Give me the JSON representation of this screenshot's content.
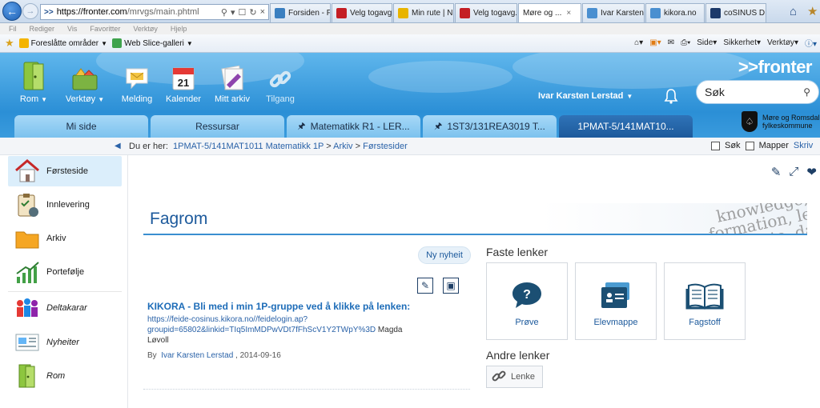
{
  "browser": {
    "address": {
      "proto": ">>",
      "host": "https://fronter.com",
      "path": "/mrvgs/main.phtml"
    },
    "tabs": [
      {
        "label": "Forsiden - F...",
        "color": "#3a7fc0",
        "active": false
      },
      {
        "label": "Velg togavg...",
        "color": "#c41e24",
        "active": false
      },
      {
        "label": "Min rute | N...",
        "color": "#e8b400",
        "active": false
      },
      {
        "label": "Velg togavg...",
        "color": "#c41e24",
        "active": false
      },
      {
        "label": "Møre og ...",
        "color": "#1d5a9c",
        "active": true
      },
      {
        "label": "Ivar Karsten ...",
        "color": "#4a8fd0",
        "active": false
      },
      {
        "label": "kikora.no",
        "color": "#4a8fd0",
        "active": false
      },
      {
        "label": "coSINUS DI...",
        "color": "#1d3a6a",
        "active": false
      }
    ],
    "tab_close": "×",
    "menu": [
      "Fil",
      "Rediger",
      "Vis",
      "Favoritter",
      "Verktøy",
      "Hjelp"
    ],
    "favorites": [
      {
        "label": "Foreslåtte områder",
        "dropdown": true
      },
      {
        "label": "Web Slice-galleri",
        "dropdown": true
      }
    ],
    "fav_right": [
      "Side",
      "Sikkerhet",
      "Verktøy"
    ]
  },
  "header": {
    "brand": ">>fronter",
    "tools": [
      {
        "label": "Rom",
        "dropdown": true,
        "icon": "room-icon"
      },
      {
        "label": "Verktøy",
        "dropdown": true,
        "icon": "tools-icon"
      },
      {
        "label": "Melding",
        "dropdown": false,
        "icon": "message-icon"
      },
      {
        "label": "Kalender",
        "dropdown": false,
        "icon": "calendar-icon",
        "day": "21"
      },
      {
        "label": "Mitt arkiv",
        "dropdown": false,
        "icon": "archive-icon"
      },
      {
        "label": "Tilgang",
        "dropdown": false,
        "icon": "access-icon",
        "dim": true
      }
    ],
    "user": "Ivar Karsten Lerstad",
    "search_placeholder": "Søk",
    "room_tabs": [
      {
        "label": "Mi side",
        "pinned": false,
        "active": false
      },
      {
        "label": "Ressursar",
        "pinned": false,
        "active": false
      },
      {
        "label": "Matematikk R1 - LER...",
        "pinned": true,
        "active": false
      },
      {
        "label": "1ST3/131REA3019 T...",
        "pinned": true,
        "active": false
      },
      {
        "label": "1PMAT-5/141MAT10...",
        "pinned": false,
        "active": true
      }
    ],
    "org": [
      "Møre og Romsdal",
      "fylkeskommune"
    ]
  },
  "breadcrumb": {
    "prefix": "Du er her:",
    "items": [
      "1PMAT-5/141MAT1011 Matematikk 1P",
      "Arkiv",
      "Førstesider"
    ],
    "separator": ">",
    "options": [
      "Søk",
      "Mapper",
      "Skriv"
    ]
  },
  "sidebar": {
    "items": [
      {
        "label": "Førsteside",
        "active": true
      },
      {
        "label": "Innlevering",
        "active": false
      },
      {
        "label": "Arkiv",
        "active": false
      },
      {
        "label": "Portefølje",
        "active": false
      },
      {
        "label": "Deltakarar",
        "active": false,
        "italic": true
      },
      {
        "label": "Nyheiter",
        "active": false,
        "italic": true
      },
      {
        "label": "Rom",
        "active": false,
        "italic": true
      }
    ]
  },
  "main": {
    "title": "Fagrom",
    "banner_words": [
      "knowledge,",
      "formation, le",
      "facts, da"
    ],
    "news_button": "Ny nyheit",
    "news": {
      "title": "KIKORA - Bli med i min 1P-gruppe ved å klikke på lenken:",
      "link": "https://feide-cosinus.kikora.no//feidelogin.ap?groupid=65802&linkid=TIq5ImMDPwVDt7fFhScV1Y2TWpY%3D",
      "link_display_1": "https://feide-cosinus.kikora.no//feidelogin.ap?",
      "link_display_2": "groupid=65802&linkid=TIq5ImMDPwVDt7fFhScV1Y2TWpY%3D",
      "after_link": "Magda",
      "after_link_2": "Løvoll",
      "by": "By",
      "author": "Ivar Karsten Lerstad",
      "date": ", 2014-09-16"
    },
    "quick_links_title": "Faste lenker",
    "quick_links": [
      {
        "label": "Prøve",
        "icon": "question-icon"
      },
      {
        "label": "Elevmappe",
        "icon": "student-folder-icon"
      },
      {
        "label": "Fagstoff",
        "icon": "book-icon"
      }
    ],
    "other_links_title": "Andre lenker",
    "other_links": [
      {
        "label": "Lenke"
      }
    ]
  },
  "colors": {
    "header_blue": "#2b8fd6",
    "active_tab": "#1d5a9c",
    "link_blue": "#1d6cb8",
    "card_icon": "#1b4f73"
  }
}
